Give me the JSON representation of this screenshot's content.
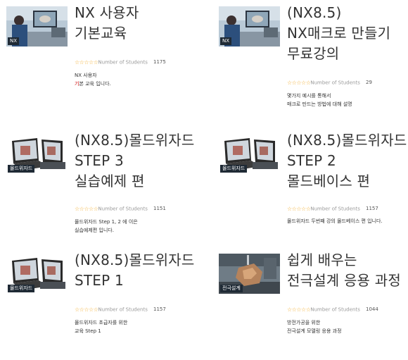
{
  "courses": [
    {
      "title": "NX 사용자\n기본교육",
      "thumb_tag": "NX",
      "thumb_kind": "photo-office",
      "stars": "☆☆☆☆☆",
      "students_label": "Number of Students",
      "students": "1175",
      "description_line1": "NX 사용자",
      "description_line2_first": "기",
      "description_line2_rest": "본 교육 입니다.",
      "rating": 0
    },
    {
      "title": "(NX8.5)\nNX매크로 만들기\n무료강의",
      "thumb_tag": "NX",
      "thumb_kind": "photo-office",
      "stars": "☆☆☆☆☆",
      "students_label": "Number of Students",
      "students": "29",
      "description": "몇가지 예시를 통해서\n매크로 만드는 방법에 대해 설명",
      "rating": 0
    },
    {
      "title": "(NX8.5)몰드위자드\nSTEP 3\n실습예제 편",
      "thumb_tag": "몰드위자드",
      "thumb_kind": "laptop",
      "stars": "☆☆☆☆☆",
      "students_label": "Number of Students",
      "students": "1151",
      "description": "몰드위자드 Step 1, 2 에 이은\n실습예제편 입니다.",
      "rating": 0
    },
    {
      "title": "(NX8.5)몰드위자드\nSTEP 2\n몰드베이스 편",
      "thumb_tag": "몰드위자드",
      "thumb_kind": "laptop",
      "stars": "☆☆☆☆☆",
      "students_label": "Number of Students",
      "students": "1157",
      "description": "몰드위자드 두번째 강의 몰드베이스 편 입니다.",
      "rating": 0
    },
    {
      "title": "(NX8.5)몰드위자드\nSTEP 1",
      "thumb_tag": "몰드위자드",
      "thumb_kind": "laptop",
      "stars": "☆☆☆☆☆",
      "students_label": "Number of Students",
      "students": "1157",
      "description": "몰드위자드 초급자를 위한\n교육 Step 1",
      "rating": 0
    },
    {
      "title": "쉽게 배우는\n전극설계 응용 과정",
      "thumb_tag": "전극설계",
      "thumb_kind": "photo-part",
      "stars": "☆☆☆☆☆",
      "students_label": "Number of Students",
      "students": "1044",
      "description": "방전가공을 위한\n전극설계 모델링 응용 과정",
      "rating": 0
    }
  ],
  "colors": {
    "star": "#f3b23a",
    "highlight": "#cc0000",
    "title": "#333333"
  }
}
